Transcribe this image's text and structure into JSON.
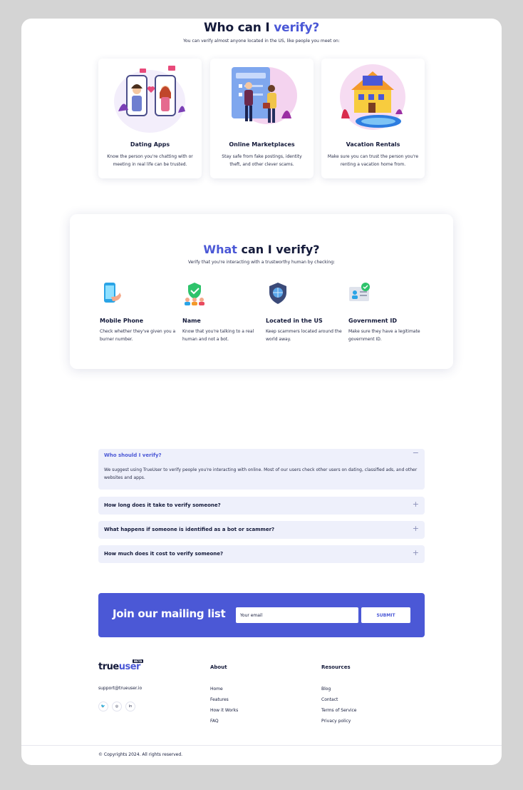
{
  "who": {
    "title_a": "Who can I ",
    "title_b": "verify?",
    "subtitle": "You can verify almost anyone located in the US, like people you meet on:",
    "cards": [
      {
        "title": "Dating Apps",
        "text": "Know the person you're chatting with or meeting in real life can be trusted."
      },
      {
        "title": "Online Marketplaces",
        "text": "Stay safe from fake postings, identity theft, and other clever scams."
      },
      {
        "title": "Vacation Rentals",
        "text": "Make sure you can trust the person you're renting a vacation home from."
      }
    ]
  },
  "what": {
    "title_a": "What",
    "title_b": " can I verify?",
    "subtitle": "Verify that you're interacting with a trustworthy human by checking:",
    "features": [
      {
        "title": "Mobile Phone",
        "text": "Check whether they've given you a burner number.",
        "icon": "mobile-phone-icon"
      },
      {
        "title": "Name",
        "text": "Know that you're talking to a real human and not a bot.",
        "icon": "name-verified-icon"
      },
      {
        "title": "Located in the US",
        "text": "Keep scammers located around the world away.",
        "icon": "globe-shield-icon"
      },
      {
        "title": "Government ID",
        "text": "Make sure they have a legitimate government ID.",
        "icon": "government-id-icon"
      }
    ]
  },
  "faq": [
    {
      "q": "Who should I verify?",
      "a": "We suggest using TrueUser to verify people you're interacting with online. Most of our users check other users on dating, classified ads, and other websites and apps.",
      "toggle": "−",
      "open": true
    },
    {
      "q": "How long does it take to verify someone?",
      "toggle": "+",
      "open": false
    },
    {
      "q": "What happens if someone is identified as a bot or scammer?",
      "toggle": "+",
      "open": false
    },
    {
      "q": "How much does it cost to verify someone?",
      "toggle": "+",
      "open": false
    }
  ],
  "mailing": {
    "title": "Join our mailing list",
    "email_value": "Your email",
    "submit": "SUBMIT"
  },
  "footer": {
    "logo_a": "true",
    "logo_b": "user",
    "beta": "BETA",
    "email": "support@trueuser.io",
    "socials": [
      {
        "icon": "twitter-icon",
        "glyph": "🐦"
      },
      {
        "icon": "instagram-icon",
        "glyph": "◎"
      },
      {
        "icon": "linkedin-icon",
        "glyph": "in"
      }
    ],
    "about": {
      "heading": "About",
      "links": [
        "Home",
        "Features",
        "How it Works",
        "FAQ"
      ]
    },
    "resources": {
      "heading": "Resources",
      "links": [
        "Blog",
        "Contact",
        "Terms of Service",
        "Privacy policy"
      ]
    },
    "copyright": "© Copyrights 2024. All rights reserved."
  },
  "colors": {
    "accent": "#4b58d6",
    "text": "#141a3a",
    "faq_bg": "#eef0fb"
  }
}
